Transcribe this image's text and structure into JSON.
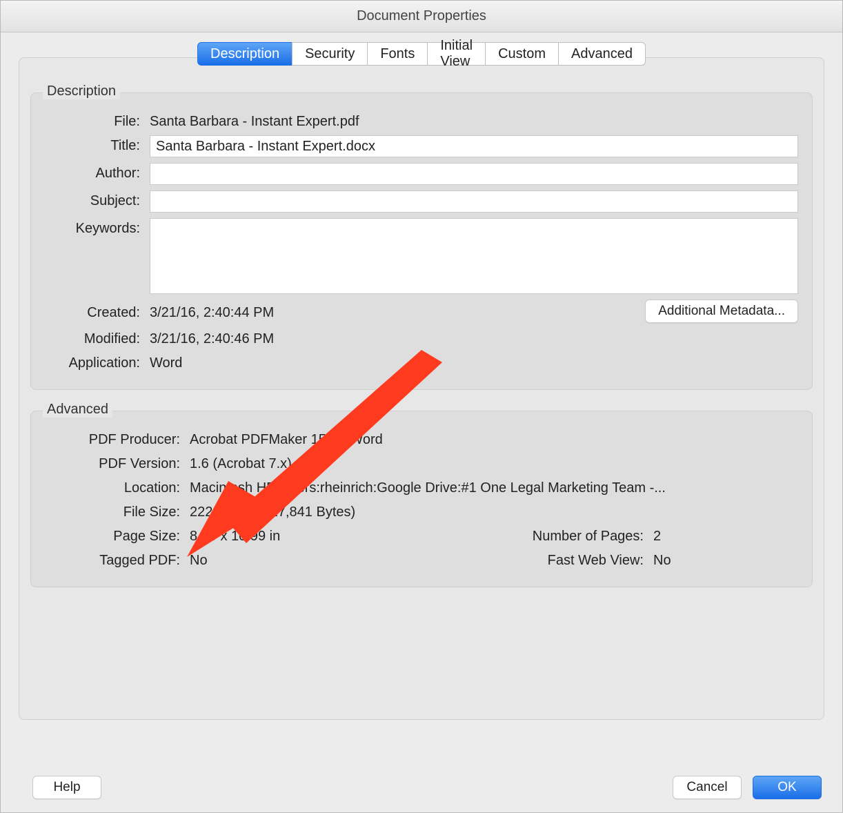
{
  "window": {
    "title": "Document Properties"
  },
  "tabs": {
    "items": [
      {
        "label": "Description",
        "active": true
      },
      {
        "label": "Security"
      },
      {
        "label": "Fonts"
      },
      {
        "label": "Initial View"
      },
      {
        "label": "Custom"
      },
      {
        "label": "Advanced"
      }
    ]
  },
  "description": {
    "title": "Description",
    "labels": {
      "file": "File:",
      "title": "Title:",
      "author": "Author:",
      "subject": "Subject:",
      "keywords": "Keywords:",
      "created": "Created:",
      "modified": "Modified:",
      "application": "Application:"
    },
    "values": {
      "file": "Santa Barbara - Instant Expert.pdf",
      "title": "Santa Barbara - Instant Expert.docx",
      "author": "",
      "subject": "",
      "keywords": "",
      "created": "3/21/16, 2:40:44 PM",
      "modified": "3/21/16, 2:40:46 PM",
      "application": "Word"
    },
    "additional_metadata_btn": "Additional Metadata..."
  },
  "advanced": {
    "title": "Advanced",
    "labels": {
      "pdf_producer": "PDF Producer:",
      "pdf_version": "PDF Version:",
      "location": "Location:",
      "file_size": "File Size:",
      "page_size": "Page Size:",
      "number_of_pages": "Number of Pages:",
      "tagged_pdf": "Tagged PDF:",
      "fast_web_view": "Fast Web View:"
    },
    "values": {
      "pdf_producer": "Acrobat PDFMaker 15 for Word",
      "pdf_version": "1.6 (Acrobat 7.x)",
      "location": "Macintosh HD:Users:rheinrich:Google Drive:#1 One Legal Marketing Team -...",
      "file_size": "222.50 KB (227,841 Bytes)",
      "page_size": "8.50 x 10.99 in",
      "number_of_pages": "2",
      "tagged_pdf": "No",
      "fast_web_view": "No"
    }
  },
  "footer": {
    "help": "Help",
    "cancel": "Cancel",
    "ok": "OK"
  },
  "annotation": {
    "color": "#ff3b1f"
  }
}
